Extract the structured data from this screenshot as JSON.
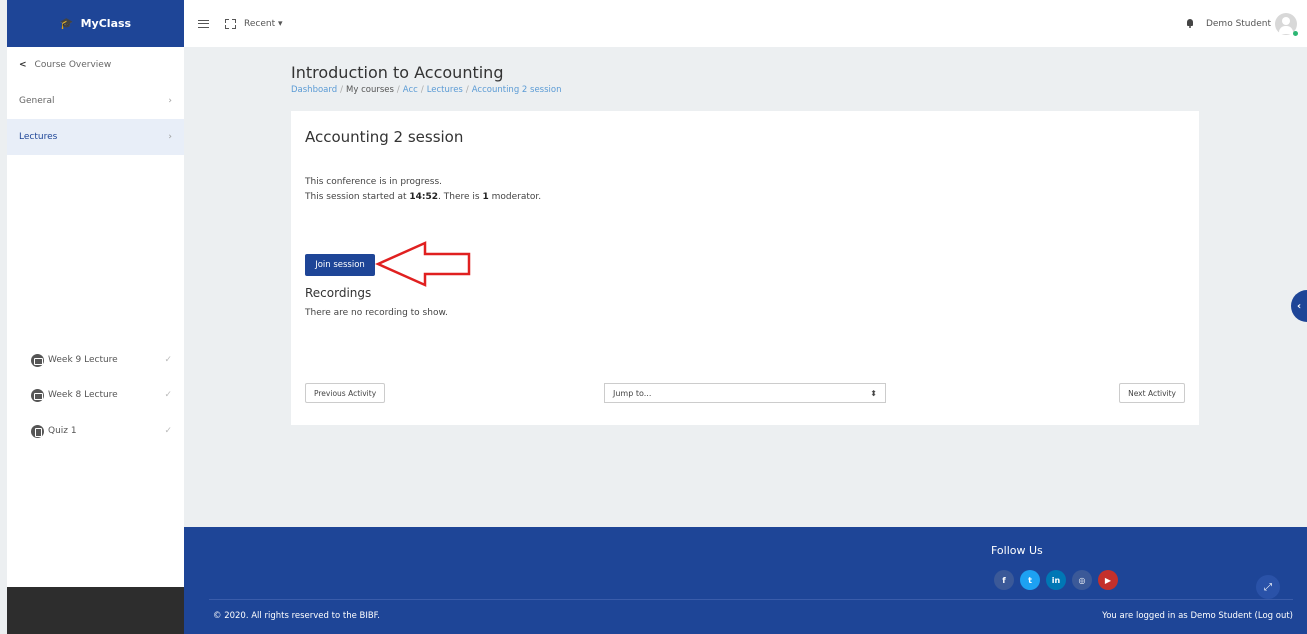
{
  "brand": {
    "name": "MyClass"
  },
  "topbar": {
    "recent": "Recent",
    "username": "Demo Student"
  },
  "sidebar": {
    "back_label": "Course Overview",
    "items": [
      {
        "label": "General"
      },
      {
        "label": "Lectures"
      }
    ],
    "activities": [
      {
        "label": "Week 9 Lecture"
      },
      {
        "label": "Week 8 Lecture"
      },
      {
        "label": "Quiz 1"
      }
    ]
  },
  "page": {
    "title": "Introduction to Accounting",
    "breadcrumb": [
      "Dashboard",
      "My courses",
      "Acc",
      "Lectures",
      "Accounting 2 session"
    ]
  },
  "session": {
    "title": "Accounting 2 session",
    "status": "This conference is in progress.",
    "started_prefix": "This session started at ",
    "started_time": "14:52",
    "started_mid": ". There is ",
    "moderator_count": "1",
    "started_suffix": " moderator.",
    "join_label": "Join session",
    "recordings_heading": "Recordings",
    "no_recordings": "There are no recording to show."
  },
  "nav": {
    "previous": "Previous Activity",
    "jump_placeholder": "Jump to...",
    "next": "Next Activity"
  },
  "footer": {
    "follow": "Follow Us",
    "social": [
      {
        "icon": "facebook-icon",
        "glyph": "f",
        "color": "#3b5998"
      },
      {
        "icon": "twitter-icon",
        "glyph": "t",
        "color": "#1da1f2"
      },
      {
        "icon": "linkedin-icon",
        "glyph": "in",
        "color": "#0077b5"
      },
      {
        "icon": "instagram-icon",
        "glyph": "◎",
        "color": "#3b5998"
      },
      {
        "icon": "youtube-icon",
        "glyph": "▶",
        "color": "#c4302b"
      }
    ],
    "copyright": "© 2020. All rights reserved to the BIBF.",
    "logged_in": "You are logged in as Demo Student (Log out)"
  },
  "colors": {
    "primary": "#1e4597",
    "link": "#5b9bd5",
    "annotation_arrow": "#e02020"
  }
}
